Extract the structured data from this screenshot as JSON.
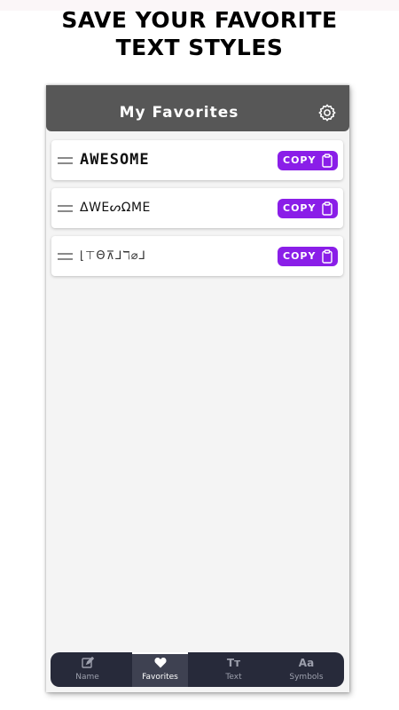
{
  "promo": {
    "line1": "SAVE YOUR FAVORITE",
    "line2": "TEXT STYLES"
  },
  "appbar": {
    "title": "My Favorites",
    "settings_icon": "gear-icon"
  },
  "favorites": [
    {
      "text": "AWESOME",
      "copy_label": "COPY"
    },
    {
      "text": "ΔWEᔕΩME",
      "copy_label": "COPY"
    },
    {
      "text": "⌊⊤Θ⊼⅃ℸ⌀⅃",
      "copy_label": "COPY"
    }
  ],
  "colors": {
    "accent": "#8a1ee8",
    "appbar": "#575757",
    "nav_background": "#272a3a"
  },
  "bottom_nav": {
    "items": [
      {
        "label": "Name",
        "icon": "edit-icon"
      },
      {
        "label": "Favorites",
        "icon": "heart-icon"
      },
      {
        "label": "Text",
        "icon": "Tт"
      },
      {
        "label": "Symbols",
        "icon": "Aa"
      }
    ],
    "active": "Favorites"
  }
}
